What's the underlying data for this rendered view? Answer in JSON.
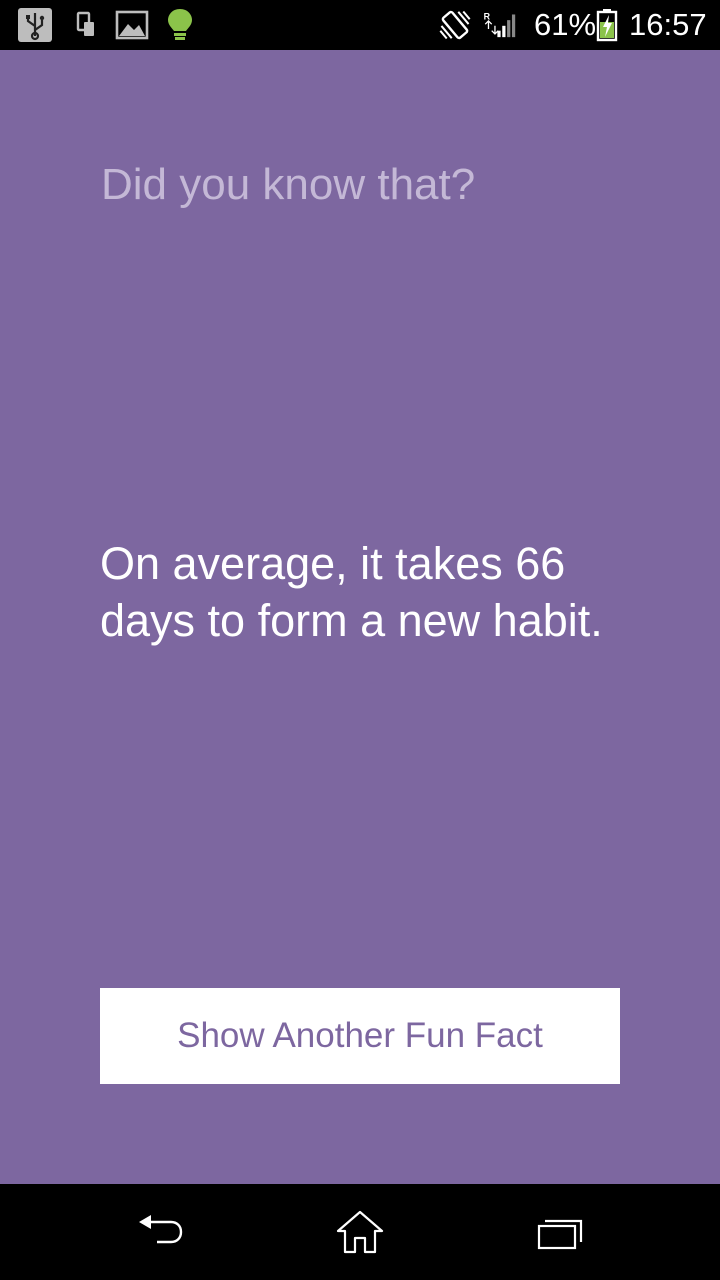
{
  "status_bar": {
    "battery_percent": "61%",
    "time": "16:57",
    "network_roaming": "R",
    "icons": [
      "usb-icon",
      "device-transfer-icon",
      "image-icon",
      "lightbulb-icon",
      "vibrate-icon",
      "signal-icon",
      "battery-charging-icon"
    ]
  },
  "main": {
    "heading": "Did you know that?",
    "fact": "On average, it takes 66 days to form a new habit.",
    "button_label": "Show Another Fun Fact"
  },
  "nav_bar": {
    "icons": [
      "back-icon",
      "home-icon",
      "recent-apps-icon"
    ]
  },
  "colors": {
    "background": "#7d67a0",
    "heading": "#c4b8d6",
    "button_text": "#7d67a0"
  }
}
